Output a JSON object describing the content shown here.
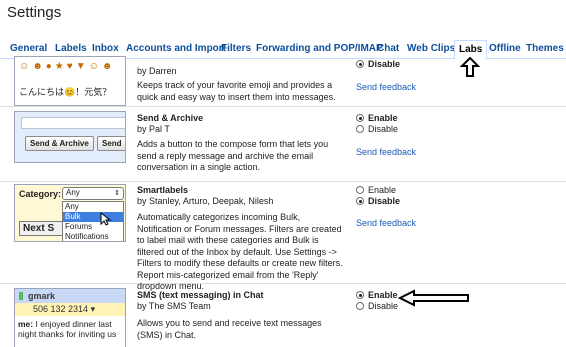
{
  "page": {
    "title": "Settings"
  },
  "tabs": [
    {
      "label": "General"
    },
    {
      "label": "Labels"
    },
    {
      "label": "Inbox"
    },
    {
      "label": "Accounts and Import"
    },
    {
      "label": "Filters"
    },
    {
      "label": "Forwarding and POP/IMAP"
    },
    {
      "label": "Chat"
    },
    {
      "label": "Web Clips"
    },
    {
      "label": "Labs",
      "active": true
    },
    {
      "label": "Offline"
    },
    {
      "label": "Themes"
    }
  ],
  "labs": [
    {
      "key": "emoji",
      "author": "by Darren",
      "description": "Keeps track of your favorite emoji and provides a quick and easy way to insert them into messages.",
      "status": "Disable",
      "options": [
        "Disable"
      ],
      "feedback": "Send feedback",
      "preview": {
        "icons": [
          "grin-face-icon",
          "smile-face-icon",
          "poop-icon",
          "star-icon",
          "heart-balloon-icon",
          "cocktail-icon",
          "face-icon",
          "face-icon"
        ],
        "japanese_text": "こんにちは😊！元気？"
      }
    },
    {
      "key": "send-archive",
      "title": "Send & Archive",
      "author": "by Pal T",
      "description": "Adds a button to the compose form that lets you send a reply message and archive the email conversation in a single action.",
      "status": "Enable",
      "options": [
        "Enable",
        "Disable"
      ],
      "feedback": "Send feedback",
      "preview": {
        "primary_button": "Send & Archive",
        "secondary_button": "Send"
      }
    },
    {
      "key": "smartlabels",
      "title": "Smartlabels",
      "author": "by Stanley, Arturo, Deepak, Nilesh",
      "description": "Automatically categorizes incoming Bulk, Notification or Forum messages. Filters are created to label mail with these categories and Bulk is filtered out of the Inbox by default. Use Settings -> Filters to modify these defaults or create new filters. Report mis-categorized email from the 'Reply' dropdown menu.",
      "status": "Disable",
      "options": [
        "Enable",
        "Disable"
      ],
      "feedback": "Send feedback",
      "preview": {
        "category_label": "Category:",
        "selected": "Any",
        "list": [
          "Any",
          "Bulk",
          "Forums",
          "Notifications"
        ],
        "highlighted": "Bulk",
        "next_button": "Next S"
      }
    },
    {
      "key": "sms-chat",
      "title": "SMS (text messaging) in Chat",
      "author": "by The SMS Team",
      "description": "Allows you to send and receive text messages (SMS) in Chat.",
      "status": "Enable",
      "options": [
        "Enable",
        "Disable"
      ],
      "feedback": "Send feedback",
      "preview": {
        "contact": "gmark",
        "phone": "506 132 2314",
        "sender": "me:",
        "message": "I enjoyed dinner last night thanks for inviting us"
      }
    }
  ],
  "colors": {
    "link": "#1c58b8",
    "tab_text": "#0e4f9c",
    "tab_border": "#c3d9ff",
    "smartlabels_bg": "#fff8d5",
    "sms_header": "#c7d9f6",
    "sms_number_bg": "#fff3b5"
  }
}
